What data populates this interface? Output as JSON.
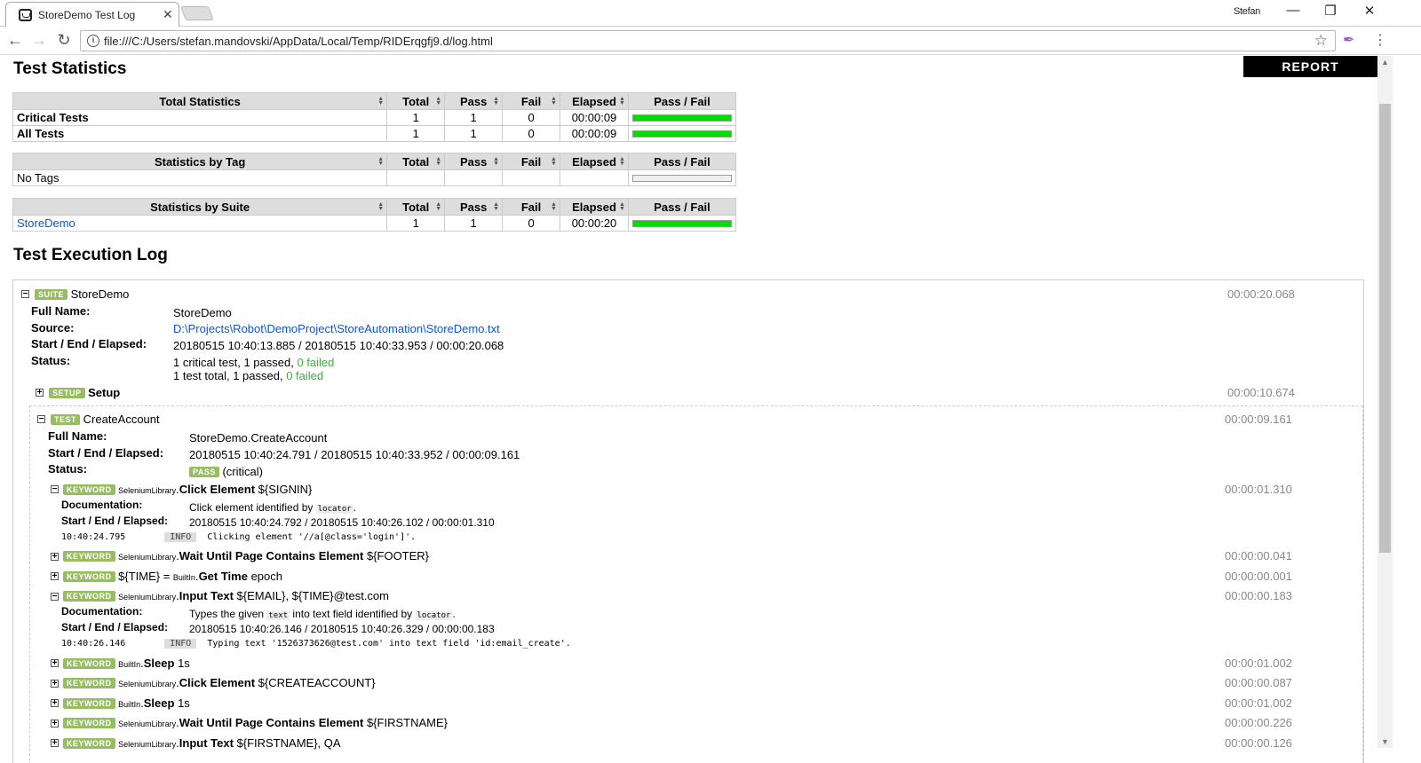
{
  "browser": {
    "tab_title": "StoreDemo Test Log",
    "profile": "Stefan",
    "url": "file:///C:/Users/stefan.mandovski/AppData/Local/Temp/RIDErqgfj9.d/log.html"
  },
  "page": {
    "stats_heading": "Test Statistics",
    "report_label": "REPORT",
    "log_heading": "Test Execution Log"
  },
  "stats": {
    "headers": {
      "total": "Total",
      "pass": "Pass",
      "fail": "Fail",
      "elapsed": "Elapsed",
      "passfail": "Pass / Fail"
    },
    "total_table": {
      "title": "Total Statistics",
      "rows": [
        {
          "name": "Critical Tests",
          "total": "1",
          "pass": "1",
          "fail": "0",
          "elapsed": "00:00:09",
          "pass_fraction": 1
        },
        {
          "name": "All Tests",
          "total": "1",
          "pass": "1",
          "fail": "0",
          "elapsed": "00:00:09",
          "pass_fraction": 1
        }
      ]
    },
    "tag_table": {
      "title": "Statistics by Tag",
      "rows": [
        {
          "name": "No Tags"
        }
      ]
    },
    "suite_table": {
      "title": "Statistics by Suite",
      "rows": [
        {
          "name": "StoreDemo",
          "total": "1",
          "pass": "1",
          "fail": "0",
          "elapsed": "00:00:20",
          "pass_fraction": 1
        }
      ]
    }
  },
  "log": {
    "suite": {
      "label": "SUITE",
      "name": "StoreDemo",
      "elapsed": "00:00:20.068",
      "full_name_k": "Full Name:",
      "full_name": "StoreDemo",
      "source_k": "Source:",
      "source": "D:\\Projects\\Robot\\DemoProject\\StoreAutomation\\StoreDemo.txt",
      "times_k": "Start / End / Elapsed:",
      "times": "20180515 10:40:13.885 / 20180515 10:40:33.953 / 00:00:20.068",
      "status_k": "Status:",
      "status1": "1 critical test, 1 passed, ",
      "status1_fail": "0 failed",
      "status2": "1 test total, 1 passed, ",
      "status2_fail": "0 failed"
    },
    "setup": {
      "label": "SETUP",
      "name": "Setup",
      "elapsed": "00:00:10.674"
    },
    "test": {
      "label": "TEST",
      "name": "CreateAccount",
      "elapsed": "00:00:09.161",
      "full_name_k": "Full Name:",
      "full_name": "StoreDemo.CreateAccount",
      "times_k": "Start / End / Elapsed:",
      "times": "20180515 10:40:24.791 / 20180515 10:40:33.952 / 00:00:09.161",
      "status_k": "Status:",
      "status_badge": "PASS",
      "status_note": "(critical)"
    },
    "kw_label": "KEYWORD",
    "info_label": "INFO",
    "keywords": [
      {
        "toggle": "−",
        "lib": "SeleniumLibrary",
        "name": "Click Element",
        "args": " ${SIGNIN}",
        "elapsed": "00:00:01.310",
        "doc_k": "Documentation:",
        "doc_a": "Click element identified by ",
        "doc_code": "locator",
        "doc_b": ".",
        "times_k": "Start / End / Elapsed:",
        "times": "20180515 10:40:24.792 / 20180515 10:40:26.102 / 00:00:01.310",
        "msg_time": "10:40:24.795",
        "msg": "Clicking element '//a[@class='login']'."
      },
      {
        "toggle": "+",
        "lib": "SeleniumLibrary",
        "name": "Wait Until Page Contains Element",
        "args": " ${FOOTER}",
        "elapsed": "00:00:00.041"
      },
      {
        "toggle": "+",
        "prefix": "${TIME} = ",
        "lib": "BuiltIn",
        "name": "Get Time",
        "args": " epoch",
        "elapsed": "00:00:00.001"
      },
      {
        "toggle": "−",
        "lib": "SeleniumLibrary",
        "name": "Input Text",
        "args": " ${EMAIL}, ${TIME}@test.com",
        "elapsed": "00:00:00.183",
        "doc_k": "Documentation:",
        "doc_a": "Types the given ",
        "doc_code": "text",
        "doc_b": " into text field identified by ",
        "doc_code2": "locator",
        "doc_c": ".",
        "times_k": "Start / End / Elapsed:",
        "times": "20180515 10:40:26.146 / 20180515 10:40:26.329 / 00:00:00.183",
        "msg_time": "10:40:26.146",
        "msg": "Typing text '1526373626@test.com' into text field 'id:email_create'."
      },
      {
        "toggle": "+",
        "lib": "BuiltIn",
        "name": "Sleep",
        "args": " 1s",
        "elapsed": "00:00:01.002"
      },
      {
        "toggle": "+",
        "lib": "SeleniumLibrary",
        "name": "Click Element",
        "args": " ${CREATEACCOUNT}",
        "elapsed": "00:00:00.087"
      },
      {
        "toggle": "+",
        "lib": "BuiltIn",
        "name": "Sleep",
        "args": " 1s",
        "elapsed": "00:00:01.002"
      },
      {
        "toggle": "+",
        "lib": "SeleniumLibrary",
        "name": "Wait Until Page Contains Element",
        "args": " ${FIRSTNAME}",
        "elapsed": "00:00:00.226"
      },
      {
        "toggle": "+",
        "lib": "SeleniumLibrary",
        "name": "Input Text",
        "args": " ${FIRSTNAME}, QA",
        "elapsed": "00:00:00.126"
      }
    ]
  }
}
